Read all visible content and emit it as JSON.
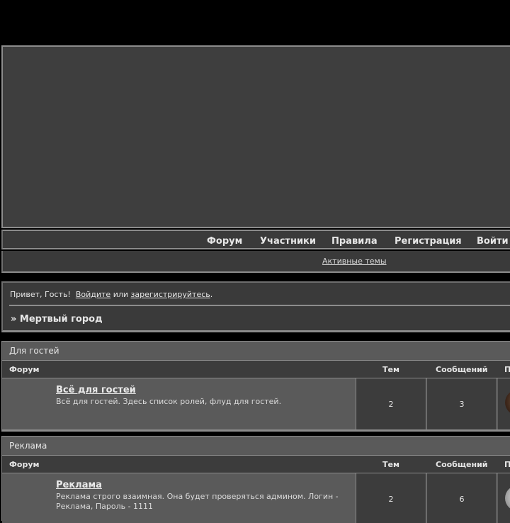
{
  "nav": {
    "items": [
      {
        "label": "Форум"
      },
      {
        "label": "Участники"
      },
      {
        "label": "Правила"
      },
      {
        "label": "Регистрация"
      },
      {
        "label": "Войти"
      }
    ],
    "active_topics": "Активные темы"
  },
  "welcome": {
    "greeting": "Привет, Гость!",
    "login_link": "Войдите",
    "or_text": "или",
    "register_link": "зарегистрируйтесь",
    "period": "."
  },
  "breadcrumb": "» Мертвый город",
  "columns": {
    "forum": "Форум",
    "topics": "Тем",
    "posts": "Сообщений",
    "last": "П"
  },
  "categories": [
    {
      "title": "Для гостей",
      "forums": [
        {
          "name": "Всё для гостей",
          "description": "Всё для гостей. Здесь список ролей, флуд для гостей.",
          "topics": "2",
          "posts": "3"
        }
      ]
    },
    {
      "title": "Реклама",
      "forums": [
        {
          "name": "Реклама",
          "description": "Реклама строго взаимная. Она будет проверяться админом. Логин - Реклама, Пароль - 1111",
          "topics": "2",
          "posts": "6"
        }
      ]
    }
  ],
  "colors": {
    "background": "#000000",
    "panel": "#3a3a3a",
    "panel_light": "#5a5a5a",
    "border": "#8c8c8c",
    "text": "#e6e6e6"
  }
}
